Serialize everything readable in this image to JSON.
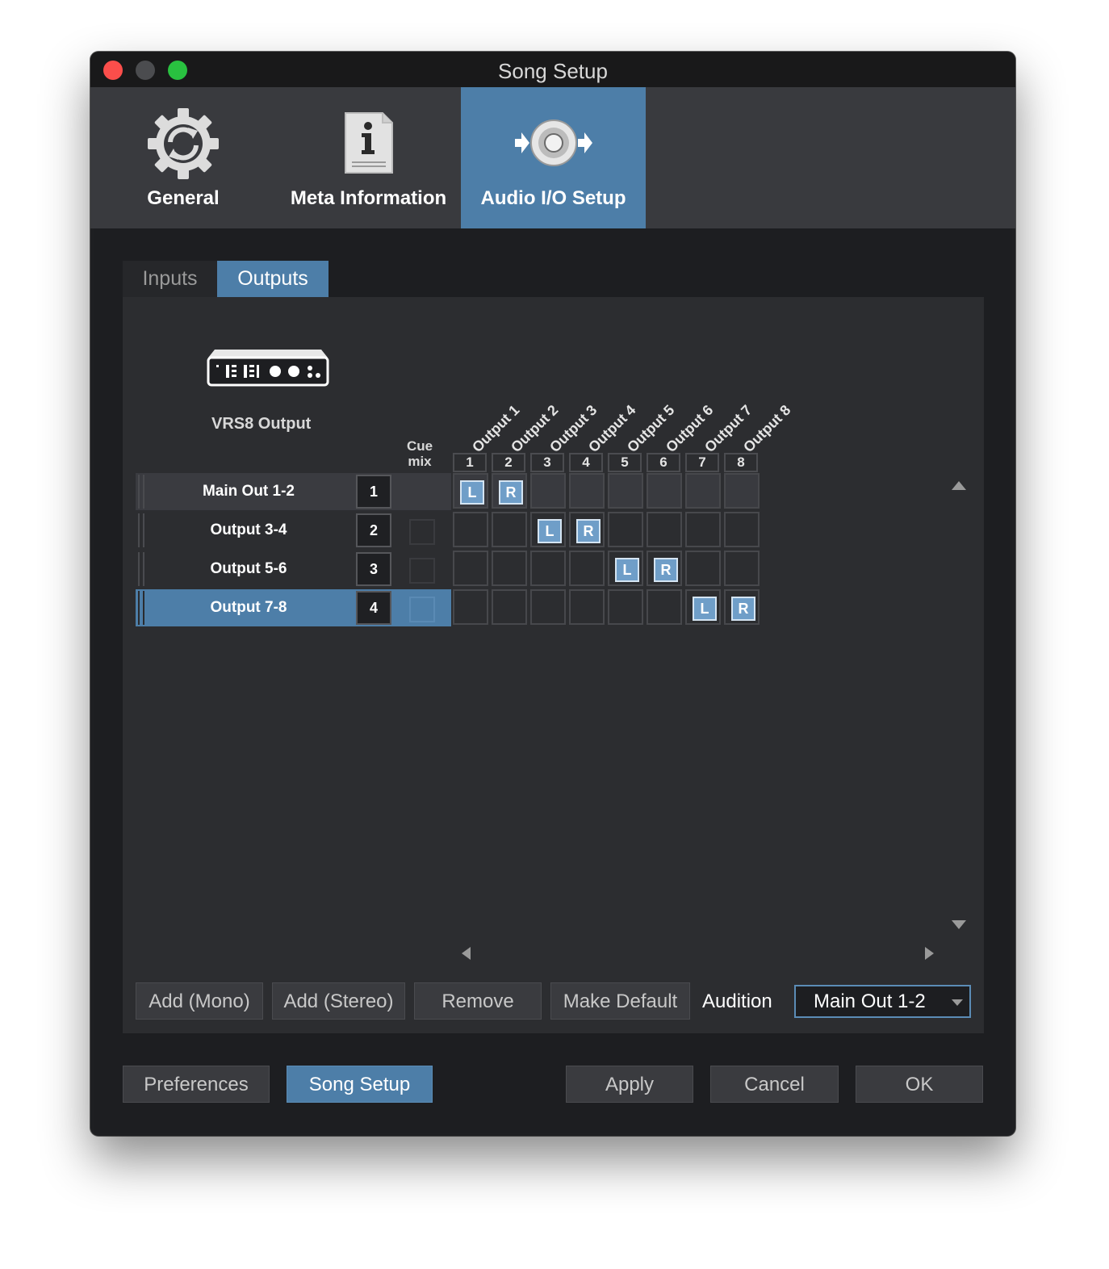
{
  "window": {
    "title": "Song Setup"
  },
  "top_tabs": [
    {
      "label": "General",
      "icon": "gear-refresh-icon",
      "active": false
    },
    {
      "label": "Meta Information",
      "icon": "info-document-icon",
      "active": false
    },
    {
      "label": "Audio I/O Setup",
      "icon": "speaker-io-icon",
      "active": true
    }
  ],
  "sub_tabs": [
    {
      "label": "Inputs",
      "active": false
    },
    {
      "label": "Outputs",
      "active": true
    }
  ],
  "device": {
    "name": "VRS8 Output",
    "icon": "audio-interface-icon"
  },
  "matrix": {
    "cue_header": [
      "Cue",
      "mix"
    ],
    "channels": [
      {
        "name": "Output 1",
        "num": "1"
      },
      {
        "name": "Output 2",
        "num": "2"
      },
      {
        "name": "Output 3",
        "num": "3"
      },
      {
        "name": "Output 4",
        "num": "4"
      },
      {
        "name": "Output 5",
        "num": "5"
      },
      {
        "name": "Output 6",
        "num": "6"
      },
      {
        "name": "Output 7",
        "num": "7"
      },
      {
        "name": "Output 8",
        "num": "8"
      }
    ],
    "rows": [
      {
        "name": "Main Out 1-2",
        "num": "1",
        "state": "highlighted",
        "cue": false,
        "assign": [
          "L",
          "R",
          "",
          "",
          "",
          "",
          "",
          ""
        ]
      },
      {
        "name": "Output 3-4",
        "num": "2",
        "state": "normal",
        "cue": true,
        "assign": [
          "",
          "",
          "L",
          "R",
          "",
          "",
          "",
          ""
        ]
      },
      {
        "name": "Output 5-6",
        "num": "3",
        "state": "normal",
        "cue": true,
        "assign": [
          "",
          "",
          "",
          "",
          "L",
          "R",
          "",
          ""
        ]
      },
      {
        "name": "Output 7-8",
        "num": "4",
        "state": "selected",
        "cue": true,
        "assign": [
          "",
          "",
          "",
          "",
          "",
          "",
          "L",
          "R"
        ]
      }
    ]
  },
  "actions": {
    "add_mono": "Add (Mono)",
    "add_stereo": "Add (Stereo)",
    "remove": "Remove",
    "make_default": "Make Default"
  },
  "audition": {
    "label": "Audition",
    "value": "Main Out 1-2"
  },
  "footer": {
    "preferences": "Preferences",
    "song_setup": "Song Setup",
    "apply": "Apply",
    "cancel": "Cancel",
    "ok": "OK"
  },
  "colors": {
    "accent": "#4d7ea8",
    "background": "#1d1e21",
    "panel": "#2c2d30",
    "traffic_close": "#fb4e4b",
    "traffic_zoom": "#29c140"
  }
}
